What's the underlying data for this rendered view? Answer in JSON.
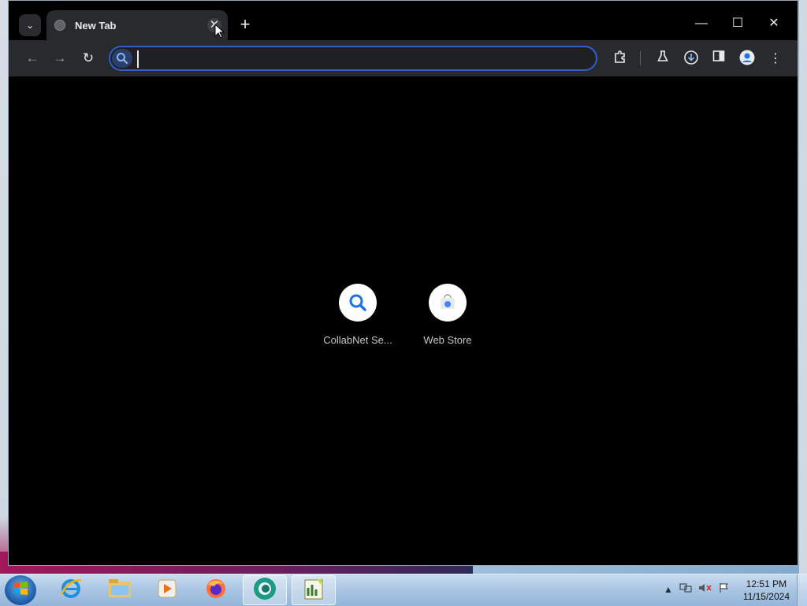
{
  "browser": {
    "tab": {
      "title": "New Tab",
      "close_label": "✕"
    },
    "new_tab_label": "+",
    "window_controls": {
      "minimize": "—",
      "maximize": "☐",
      "close": "✕"
    },
    "omnibox": {
      "value": "",
      "placeholder": ""
    }
  },
  "shortcuts": [
    {
      "label": "CollabNet Se...",
      "icon": "search-icon"
    },
    {
      "label": "Web Store",
      "icon": "web-store-icon"
    }
  ],
  "taskbar": {
    "apps": [
      "internet-explorer-icon",
      "file-explorer-icon",
      "media-player-icon",
      "firefox-icon",
      "chrome-icon",
      "spreadsheet-icon"
    ],
    "clock": {
      "time": "12:51 PM",
      "date": "11/15/2024"
    }
  },
  "colors": {
    "accent": "#2f5fcd",
    "background": "#000000",
    "toolbar": "#282a2d"
  }
}
